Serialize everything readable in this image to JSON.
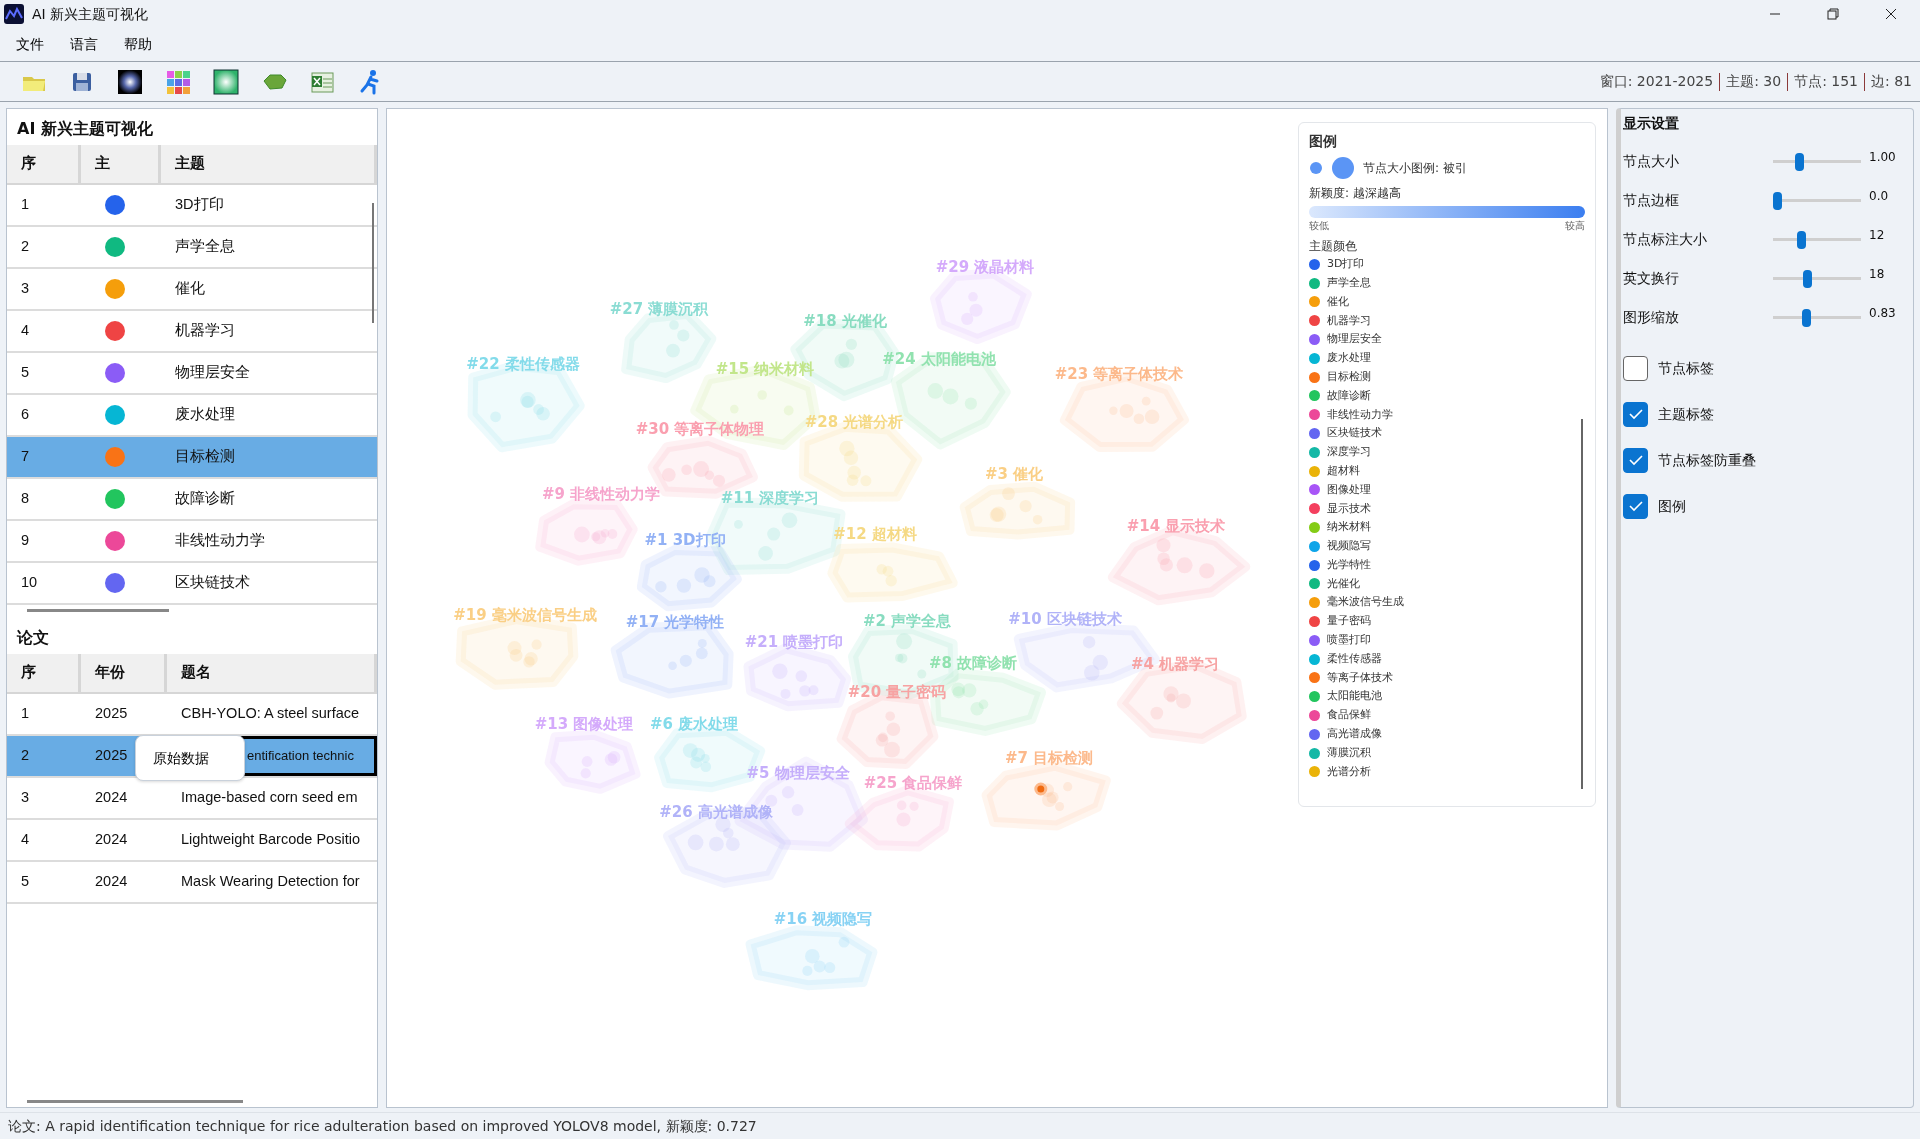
{
  "window": {
    "title": "AI 新兴主题可视化"
  },
  "menu": [
    "文件",
    "语言",
    "帮助"
  ],
  "toolbar": {
    "stats": [
      "窗口: 2021-2025",
      "主题: 30",
      "节点: 151",
      "边: 81"
    ]
  },
  "topics_panel": {
    "title": "AI 新兴主题可视化",
    "columns": [
      "序",
      "主",
      "主题"
    ],
    "rows": [
      {
        "index": "1",
        "topic": "3D打印",
        "color": "#2563eb",
        "selected": false
      },
      {
        "index": "2",
        "topic": "声学全息",
        "color": "#10b981",
        "selected": false
      },
      {
        "index": "3",
        "topic": "催化",
        "color": "#f59e0b",
        "selected": false
      },
      {
        "index": "4",
        "topic": "机器学习",
        "color": "#ef4444",
        "selected": false
      },
      {
        "index": "5",
        "topic": "物理层安全",
        "color": "#8b5cf6",
        "selected": false
      },
      {
        "index": "6",
        "topic": "废水处理",
        "color": "#06b6d4",
        "selected": false
      },
      {
        "index": "7",
        "topic": "目标检测",
        "color": "#f97316",
        "selected": true
      },
      {
        "index": "8",
        "topic": "故障诊断",
        "color": "#22c55e",
        "selected": false
      },
      {
        "index": "9",
        "topic": "非线性动力学",
        "color": "#ec4899",
        "selected": false
      },
      {
        "index": "10",
        "topic": "区块链技术",
        "color": "#6366f1",
        "selected": false
      }
    ]
  },
  "papers_panel": {
    "title": "论文",
    "columns": [
      "序",
      "年份",
      "题名"
    ],
    "rows": [
      {
        "index": "1",
        "year": "2025",
        "title": "CBH-YOLO: A steel surface",
        "selected": false
      },
      {
        "index": "2",
        "year": "2025",
        "title": "entification technic",
        "selected": true
      },
      {
        "index": "3",
        "year": "2024",
        "title": "Image-based corn seed em",
        "selected": false
      },
      {
        "index": "4",
        "year": "2024",
        "title": "Lightweight Barcode Positio",
        "selected": false
      },
      {
        "index": "5",
        "year": "2024",
        "title": "Mask Wearing Detection for",
        "selected": false
      }
    ]
  },
  "context_menu": {
    "items": [
      "原始数据"
    ]
  },
  "graph": {
    "clusters": [
      {
        "label": "#29 液晶材料",
        "color": "#d4aafb",
        "selected": false
      },
      {
        "label": "#27 薄膜沉积",
        "color": "#8adcd3",
        "selected": false
      },
      {
        "label": "#18 光催化",
        "color": "#88dcc0",
        "selected": false
      },
      {
        "label": "#22 柔性传感器",
        "color": "#83dbea",
        "selected": false
      },
      {
        "label": "#15 纳米材料",
        "color": "#c2e68b",
        "selected": false
      },
      {
        "label": "#24 太阳能电池",
        "color": "#91e2af",
        "selected": false
      },
      {
        "label": "#23 等离子体技术",
        "color": "#fcb98b",
        "selected": false
      },
      {
        "label": "#30 等离子体物理",
        "color": "#fa9faf",
        "selected": false
      },
      {
        "label": "#28 光谱分析",
        "color": "#f5d984",
        "selected": false
      },
      {
        "label": "#3 催化",
        "color": "#facf85",
        "selected": false
      },
      {
        "label": "#9 非线性动力学",
        "color": "#f6a4cc",
        "selected": false
      },
      {
        "label": "#11 深度学习",
        "color": "#8adcd3",
        "selected": false
      },
      {
        "label": "#14 显示技术",
        "color": "#fa9faf",
        "selected": false
      },
      {
        "label": "#1 3D打印",
        "color": "#92b1f5",
        "selected": false
      },
      {
        "label": "#12 超材料",
        "color": "#f5d984",
        "selected": false
      },
      {
        "label": "#19 毫米波信号生成",
        "color": "#facf85",
        "selected": false
      },
      {
        "label": "#17 光学特性",
        "color": "#92b1f5",
        "selected": false
      },
      {
        "label": "#2 声学全息",
        "color": "#88dcc0",
        "selected": false
      },
      {
        "label": "#10 区块链技术",
        "color": "#b1b3f8",
        "selected": false
      },
      {
        "label": "#21 喷墨打印",
        "color": "#c5aefb",
        "selected": false
      },
      {
        "label": "#8 故障诊断",
        "color": "#91e2af",
        "selected": false
      },
      {
        "label": "#4 机器学习",
        "color": "#f7a2a2",
        "selected": false
      },
      {
        "label": "#20 量子密码",
        "color": "#f7a2a2",
        "selected": false
      },
      {
        "label": "#13 图像处理",
        "color": "#d4aafb",
        "selected": false
      },
      {
        "label": "#6 废水处理",
        "color": "#83dbea",
        "selected": false
      },
      {
        "label": "#7 目标检测",
        "color": "#fcb98b",
        "selected": true
      },
      {
        "label": "#5 物理层安全",
        "color": "#c5aefb",
        "selected": false
      },
      {
        "label": "#25 食品保鲜",
        "color": "#f6a4cc",
        "selected": false
      },
      {
        "label": "#26 高光谱成像",
        "color": "#b1b3f8",
        "selected": false
      },
      {
        "label": "#16 视频隐写",
        "color": "#87d2f4",
        "selected": false
      }
    ]
  },
  "legend": {
    "title": "图例",
    "size_label": "节点大小图例: 被引",
    "novelty_label": "新颖度: 越深越高",
    "low": "较低",
    "high": "较高",
    "colors_title": "主题颜色",
    "items": [
      {
        "label": "3D打印",
        "color": "#2563eb"
      },
      {
        "label": "声学全息",
        "color": "#10b981"
      },
      {
        "label": "催化",
        "color": "#f59e0b"
      },
      {
        "label": "机器学习",
        "color": "#ef4444"
      },
      {
        "label": "物理层安全",
        "color": "#8b5cf6"
      },
      {
        "label": "废水处理",
        "color": "#06b6d4"
      },
      {
        "label": "目标检测",
        "color": "#f97316"
      },
      {
        "label": "故障诊断",
        "color": "#22c55e"
      },
      {
        "label": "非线性动力学",
        "color": "#ec4899"
      },
      {
        "label": "区块链技术",
        "color": "#6366f1"
      },
      {
        "label": "深度学习",
        "color": "#14b8a6"
      },
      {
        "label": "超材料",
        "color": "#eab308"
      },
      {
        "label": "图像处理",
        "color": "#a855f7"
      },
      {
        "label": "显示技术",
        "color": "#f43f5e"
      },
      {
        "label": "纳米材料",
        "color": "#84cc16"
      },
      {
        "label": "视频隐写",
        "color": "#0ea5e9"
      },
      {
        "label": "光学特性",
        "color": "#2563eb"
      },
      {
        "label": "光催化",
        "color": "#10b981"
      },
      {
        "label": "毫米波信号生成",
        "color": "#f59e0b"
      },
      {
        "label": "量子密码",
        "color": "#ef4444"
      },
      {
        "label": "喷墨打印",
        "color": "#8b5cf6"
      },
      {
        "label": "柔性传感器",
        "color": "#06b6d4"
      },
      {
        "label": "等离子体技术",
        "color": "#f97316"
      },
      {
        "label": "太阳能电池",
        "color": "#22c55e"
      },
      {
        "label": "食品保鲜",
        "color": "#ec4899"
      },
      {
        "label": "高光谱成像",
        "color": "#6366f1"
      },
      {
        "label": "薄膜沉积",
        "color": "#14b8a6"
      },
      {
        "label": "光谱分析",
        "color": "#eab308"
      }
    ]
  },
  "settings": {
    "title": "显示设置",
    "sliders": [
      {
        "label": "节点大小",
        "value": "1.00",
        "level": 0.28
      },
      {
        "label": "节点边框",
        "value": "0.0",
        "level": 0.0
      },
      {
        "label": "节点标注大小",
        "value": "12",
        "level": 0.31
      },
      {
        "label": "英文换行",
        "value": "18",
        "level": 0.38
      },
      {
        "label": "图形缩放",
        "value": "0.83",
        "level": 0.37
      }
    ],
    "checkboxes": [
      {
        "label": "节点标签",
        "checked": false
      },
      {
        "label": "主题标签",
        "checked": true
      },
      {
        "label": "节点标签防重叠",
        "checked": true
      },
      {
        "label": "图例",
        "checked": true
      }
    ]
  },
  "status_bar": "论文: A rapid identification technique for rice adulteration based on improved YOLOV8 model, 新颖度: 0.727"
}
